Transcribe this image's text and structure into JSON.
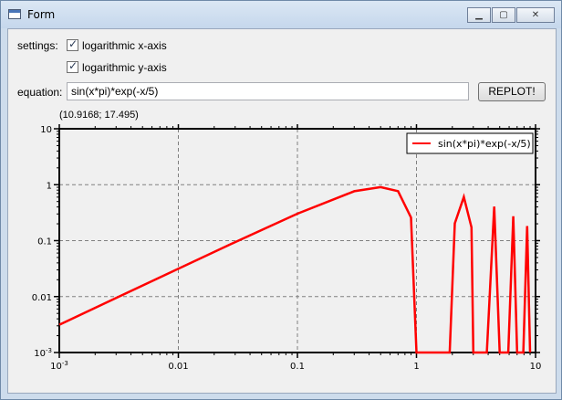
{
  "window": {
    "title": "Form"
  },
  "settings": {
    "label": "settings:",
    "log_x": {
      "label": "logarithmic x-axis",
      "checked": true
    },
    "log_y": {
      "label": "logarithmic y-axis",
      "checked": true
    }
  },
  "equation": {
    "label": "equation:",
    "value": "sin(x*pi)*exp(-x/5)"
  },
  "replot_label": "REPLOT!",
  "cursor_readout": "(10.9168; 17.495)",
  "chart_data": {
    "type": "line",
    "x_scale": "log",
    "y_scale": "log",
    "xlim": [
      0.001,
      10
    ],
    "ylim": [
      0.001,
      10
    ],
    "x_ticks": [
      {
        "base": "10",
        "exp": "-3"
      },
      {
        "label": "0.01"
      },
      {
        "label": "0.1"
      },
      {
        "label": "1"
      },
      {
        "label": "10"
      }
    ],
    "y_ticks": [
      {
        "base": "10",
        "exp": "-3"
      },
      {
        "label": "0.01"
      },
      {
        "label": "0.1"
      },
      {
        "label": "1"
      },
      {
        "label": "10"
      }
    ],
    "grid": true,
    "legend_position": "top-right",
    "series": [
      {
        "name": "sin(x*pi)*exp(-x/5)",
        "color": "#ff0000",
        "x": [
          0.001,
          0.003,
          0.01,
          0.03,
          0.1,
          0.3,
          0.5,
          0.7,
          0.9,
          1.0,
          1.9,
          2.1,
          2.5,
          2.9,
          3.0,
          3.9,
          4.5,
          5.0,
          5.9,
          6.5,
          7.0,
          7.9,
          8.5,
          9.0
        ],
        "y": [
          0.00314,
          0.00942,
          0.0314,
          0.0941,
          0.3031,
          0.7633,
          0.9048,
          0.7658,
          0.2589,
          0.001,
          0.001,
          0.2033,
          0.6065,
          0.1722,
          0.001,
          0.001,
          0.4066,
          0.001,
          0.001,
          0.2725,
          0.001,
          0.001,
          0.1827,
          0.001
        ]
      }
    ]
  }
}
